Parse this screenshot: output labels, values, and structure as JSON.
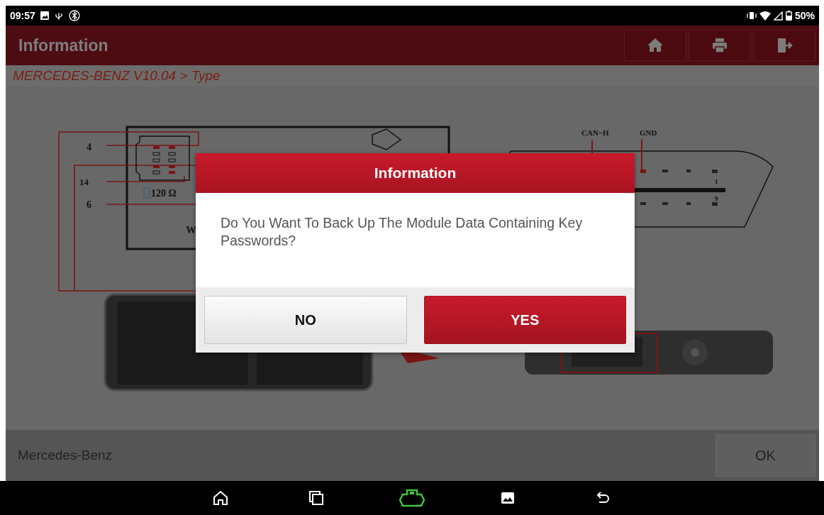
{
  "status_bar": {
    "time": "09:57",
    "battery": "50%"
  },
  "header": {
    "title": "Information",
    "buttons": [
      {
        "kind": "home"
      },
      {
        "kind": "print"
      },
      {
        "kind": "exit"
      }
    ]
  },
  "breadcrumb": "MERCEDES-BENZ V10.04 > Type",
  "diagram": {
    "labels": [
      "4",
      "14",
      "6",
      "120 Ω",
      "W",
      "CAN−H",
      "GND",
      "1",
      "9"
    ]
  },
  "dialog": {
    "title": "Information",
    "message": "Do You Want To Back Up The Module Data Containing Key Passwords?",
    "buttons": [
      {
        "label": "NO",
        "primary": false
      },
      {
        "label": "YES",
        "primary": true
      }
    ]
  },
  "footer": {
    "label": "Mercedes-Benz",
    "button": "OK"
  },
  "nav_bar": {
    "buttons": [
      {
        "kind": "home"
      },
      {
        "kind": "recents"
      },
      {
        "kind": "vci"
      },
      {
        "kind": "gallery"
      },
      {
        "kind": "back"
      }
    ]
  }
}
